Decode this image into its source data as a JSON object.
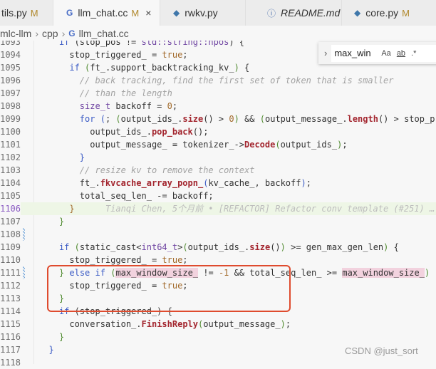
{
  "tabs": [
    {
      "label": "tils.py",
      "status": "M",
      "icon": "python-icon"
    },
    {
      "label": "llm_chat.cc",
      "status": "M",
      "icon": "cpp-icon",
      "active": true,
      "close": "×"
    },
    {
      "label": "rwkv.py",
      "icon": "python-icon"
    },
    {
      "label": "README.md",
      "icon": "info-icon"
    },
    {
      "label": "core.py",
      "status": "M",
      "icon": "python-icon"
    }
  ],
  "breadcrumb": [
    "mlc-llm",
    "cpp",
    "llm_chat.cc"
  ],
  "find": {
    "value": "max_win",
    "match_case": "Aa",
    "whole_word": "ab",
    "regex": ".*"
  },
  "colors": {
    "keyword": "#3b5bc5",
    "member": "#6e43a1",
    "function": "#a3262f",
    "highlight": "#f2d2de",
    "annotation_box": "#df4b2e"
  },
  "current_line": 1106,
  "lines": [
    {
      "n": 1093,
      "t": [
        [
          "    ",
          ""
        ],
        [
          "if",
          "k"
        ],
        [
          " (stop_pos != ",
          ""
        ],
        [
          "std::string::npos",
          "v"
        ],
        [
          ") {",
          ""
        ]
      ]
    },
    {
      "n": 1094,
      "t": [
        [
          "      stop_triggered_ = ",
          ""
        ],
        [
          "true",
          "n"
        ],
        [
          ";",
          ""
        ]
      ]
    },
    {
      "n": 1095,
      "t": [
        [
          "      ",
          ""
        ],
        [
          "if",
          "k"
        ],
        [
          " ",
          ""
        ],
        [
          "(",
          "p"
        ],
        [
          "ft_.support_backtracking_kv_",
          ""
        ],
        [
          ")",
          "p"
        ],
        [
          " {",
          ""
        ]
      ]
    },
    {
      "n": 1096,
      "t": [
        [
          "        ",
          ""
        ],
        [
          "// back tracking, find the first set of token that is smaller",
          "c"
        ]
      ]
    },
    {
      "n": 1097,
      "t": [
        [
          "        ",
          ""
        ],
        [
          "// than the length",
          "c"
        ]
      ]
    },
    {
      "n": 1098,
      "t": [
        [
          "        ",
          ""
        ],
        [
          "size_t",
          "v"
        ],
        [
          " backoff = ",
          ""
        ],
        [
          "0",
          "n"
        ],
        [
          ";",
          ""
        ]
      ]
    },
    {
      "n": 1099,
      "t": [
        [
          "        ",
          ""
        ],
        [
          "for",
          "k"
        ],
        [
          " ",
          ""
        ],
        [
          "(",
          "k"
        ],
        [
          "; ",
          ""
        ],
        [
          "(",
          "p"
        ],
        [
          "output_ids_.",
          ""
        ],
        [
          "size",
          "f"
        ],
        [
          "()",
          ""
        ],
        [
          " > ",
          ""
        ],
        [
          "0",
          "n"
        ],
        [
          ")",
          "p"
        ],
        [
          " && ",
          ""
        ],
        [
          "(",
          "p"
        ],
        [
          "output_message_.",
          ""
        ],
        [
          "length",
          "f"
        ],
        [
          "()",
          ""
        ],
        [
          " > stop_p",
          ""
        ]
      ]
    },
    {
      "n": 1100,
      "t": [
        [
          "          ",
          ""
        ],
        [
          "output_ids_.",
          ""
        ],
        [
          "pop_back",
          "f"
        ],
        [
          "();",
          ""
        ]
      ]
    },
    {
      "n": 1101,
      "t": [
        [
          "          output_message_ = ",
          ""
        ],
        [
          "tokenizer_",
          ""
        ],
        [
          "->",
          ""
        ],
        [
          "Decode",
          "f"
        ],
        [
          "(",
          "p"
        ],
        [
          "output_ids_",
          ""
        ],
        [
          ")",
          "p"
        ],
        [
          ";",
          ""
        ]
      ]
    },
    {
      "n": 1102,
      "t": [
        [
          "        ",
          ""
        ],
        [
          "}",
          "k"
        ]
      ]
    },
    {
      "n": 1103,
      "t": [
        [
          "        ",
          ""
        ],
        [
          "// resize kv to remove the context",
          "c"
        ]
      ]
    },
    {
      "n": 1104,
      "t": [
        [
          "        ft_.",
          ""
        ],
        [
          "fkvcache_array_popn_",
          "f"
        ],
        [
          "(",
          "k"
        ],
        [
          "kv_cache_, backoff",
          ""
        ],
        [
          ")",
          "k"
        ],
        [
          ";",
          ""
        ]
      ]
    },
    {
      "n": 1105,
      "t": [
        [
          "        total_seq_len_ -= backoff;",
          ""
        ]
      ]
    },
    {
      "n": 1106,
      "t": [
        [
          "      ",
          ""
        ],
        [
          "}",
          "n"
        ]
      ],
      "blame": "Tianqi Chen, 5个月前 • [REFACTOR] Refactor conv template (#251) …"
    },
    {
      "n": 1107,
      "t": [
        [
          "    ",
          ""
        ],
        [
          "}",
          "p"
        ]
      ]
    },
    {
      "n": 1108,
      "t": [],
      "git": true
    },
    {
      "n": 1109,
      "t": [
        [
          "    ",
          ""
        ],
        [
          "if",
          "k"
        ],
        [
          " ",
          ""
        ],
        [
          "(",
          "p"
        ],
        [
          "static_cast<",
          ""
        ],
        [
          "int64_t",
          "v"
        ],
        [
          ">",
          ""
        ],
        [
          "(",
          "p"
        ],
        [
          "output_ids_.",
          ""
        ],
        [
          "size",
          "f"
        ],
        [
          "()",
          ""
        ],
        [
          ")",
          "p"
        ],
        [
          " >= gen_max_gen_len",
          ""
        ],
        [
          ")",
          "p"
        ],
        [
          " {",
          ""
        ]
      ]
    },
    {
      "n": 1110,
      "t": [
        [
          "      stop_triggered_ = ",
          ""
        ],
        [
          "true",
          "n"
        ],
        [
          ";",
          ""
        ]
      ]
    },
    {
      "n": 1111,
      "t": [
        [
          "    ",
          ""
        ],
        [
          "}",
          "p"
        ],
        [
          " ",
          ""
        ],
        [
          "else",
          "k"
        ],
        [
          " ",
          ""
        ],
        [
          "if",
          "k"
        ],
        [
          " ",
          ""
        ],
        [
          "(",
          "p"
        ],
        [
          "max_window_size_",
          "hl"
        ],
        [
          " != ",
          ""
        ],
        [
          "-1",
          "n"
        ],
        [
          " && total_seq_len_ >= ",
          ""
        ],
        [
          "max_window_size_",
          "hl"
        ],
        [
          ")",
          "p"
        ]
      ],
      "git": true
    },
    {
      "n": 1112,
      "t": [
        [
          "      stop_triggered_ = ",
          ""
        ],
        [
          "true",
          "n"
        ],
        [
          ";",
          ""
        ]
      ]
    },
    {
      "n": 1113,
      "t": [
        [
          "    ",
          ""
        ],
        [
          "}",
          "p"
        ]
      ]
    },
    {
      "n": 1114,
      "t": [
        [
          "    ",
          ""
        ],
        [
          "if",
          "k"
        ],
        [
          " (stop_triggered_) {",
          ""
        ]
      ]
    },
    {
      "n": 1115,
      "t": [
        [
          "      ",
          ""
        ],
        [
          "conversation_",
          ""
        ],
        [
          ".",
          ""
        ],
        [
          "FinishReply",
          "f"
        ],
        [
          "(",
          "p"
        ],
        [
          "output_message_",
          ""
        ],
        [
          ")",
          "p"
        ],
        [
          ";",
          ""
        ]
      ]
    },
    {
      "n": 1116,
      "t": [
        [
          "    ",
          ""
        ],
        [
          "}",
          "p"
        ]
      ]
    },
    {
      "n": 1117,
      "t": [
        [
          "  ",
          ""
        ],
        [
          "}",
          "k"
        ]
      ]
    },
    {
      "n": 1118,
      "t": []
    }
  ],
  "watermark": "CSDN @just_sort"
}
